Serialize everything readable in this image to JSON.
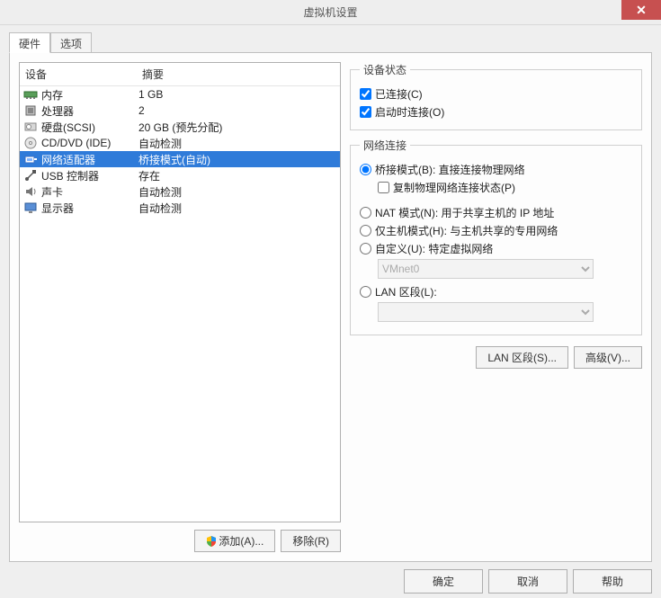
{
  "window": {
    "title": "虚拟机设置",
    "close": "✕"
  },
  "tabs": {
    "hardware": "硬件",
    "options": "选项"
  },
  "columns": {
    "device": "设备",
    "summary": "摘要"
  },
  "devices": [
    {
      "name": "内存",
      "summary": "1 GB"
    },
    {
      "name": "处理器",
      "summary": "2"
    },
    {
      "name": "硬盘(SCSI)",
      "summary": "20 GB (预先分配)"
    },
    {
      "name": "CD/DVD (IDE)",
      "summary": "自动检测"
    },
    {
      "name": "网络适配器",
      "summary": "桥接模式(自动)"
    },
    {
      "name": "USB 控制器",
      "summary": "存在"
    },
    {
      "name": "声卡",
      "summary": "自动检测"
    },
    {
      "name": "显示器",
      "summary": "自动检测"
    }
  ],
  "leftButtons": {
    "add": "添加(A)...",
    "remove": "移除(R)"
  },
  "status": {
    "legend": "设备状态",
    "connected": "已连接(C)",
    "connectAtPowerOn": "启动时连接(O)"
  },
  "network": {
    "legend": "网络连接",
    "bridged": "桥接模式(B): 直接连接物理网络",
    "replicate": "复制物理网络连接状态(P)",
    "nat": "NAT 模式(N): 用于共享主机的 IP 地址",
    "hostOnly": "仅主机模式(H): 与主机共享的专用网络",
    "custom": "自定义(U): 特定虚拟网络",
    "vmnet": "VMnet0",
    "lanSegment": "LAN 区段(L):",
    "lanSegmentsBtn": "LAN 区段(S)...",
    "advancedBtn": "高级(V)..."
  },
  "bottom": {
    "ok": "确定",
    "cancel": "取消",
    "help": "帮助"
  }
}
